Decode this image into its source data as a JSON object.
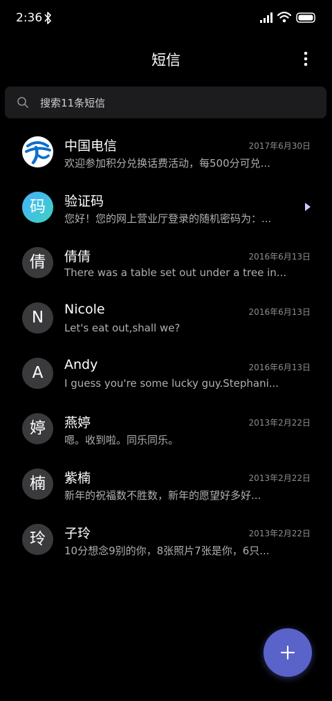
{
  "status_bar": {
    "time": "2:36"
  },
  "header": {
    "title": "短信"
  },
  "search": {
    "placeholder": "搜索11条短信"
  },
  "conversations": [
    {
      "name": "中国电信",
      "date": "2017年6月30日",
      "preview": "欢迎参加积分兑换话费活动，每500分可兑...",
      "avatar_type": "telecom-logo"
    },
    {
      "name": "验证码",
      "avatar_text": "码",
      "preview": "您好！您的网上营业厅登录的随机密码为：...",
      "avatar_type": "verify-badge"
    },
    {
      "name": "倩倩",
      "avatar_text": "倩",
      "date": "2016年6月13日",
      "preview": "There was a table set out under a tree in..."
    },
    {
      "name": "Nicole",
      "avatar_text": "N",
      "date": "2016年6月13日",
      "preview": "Let's eat out,shall we?"
    },
    {
      "name": "Andy",
      "avatar_text": "A",
      "date": "2016年6月13日",
      "preview": "I guess you're some lucky guy.Stephani..."
    },
    {
      "name": "燕婷",
      "avatar_text": "婷",
      "date": "2013年2月22日",
      "preview": "嗯。收到啦。同乐同乐。"
    },
    {
      "name": "紫楠",
      "avatar_text": "楠",
      "date": "2013年2月22日",
      "preview": "新年的祝福数不胜数，新年的愿望好多好..."
    },
    {
      "name": "子玲",
      "avatar_text": "玲",
      "date": "2013年2月22日",
      "preview": "10分想念9别的你，8张照片7张是你，6只..."
    }
  ],
  "colors": {
    "background": "#000000",
    "search_bg": "#1c1c1e",
    "fab": "#5a63c9",
    "avatar_bg": "#3a3a3c"
  },
  "icons": [
    "bluetooth-icon",
    "signal-icon",
    "wifi-icon",
    "battery-icon",
    "more-icon",
    "search-icon",
    "telecom-logo-icon",
    "arrow-right-icon",
    "plus-icon"
  ]
}
